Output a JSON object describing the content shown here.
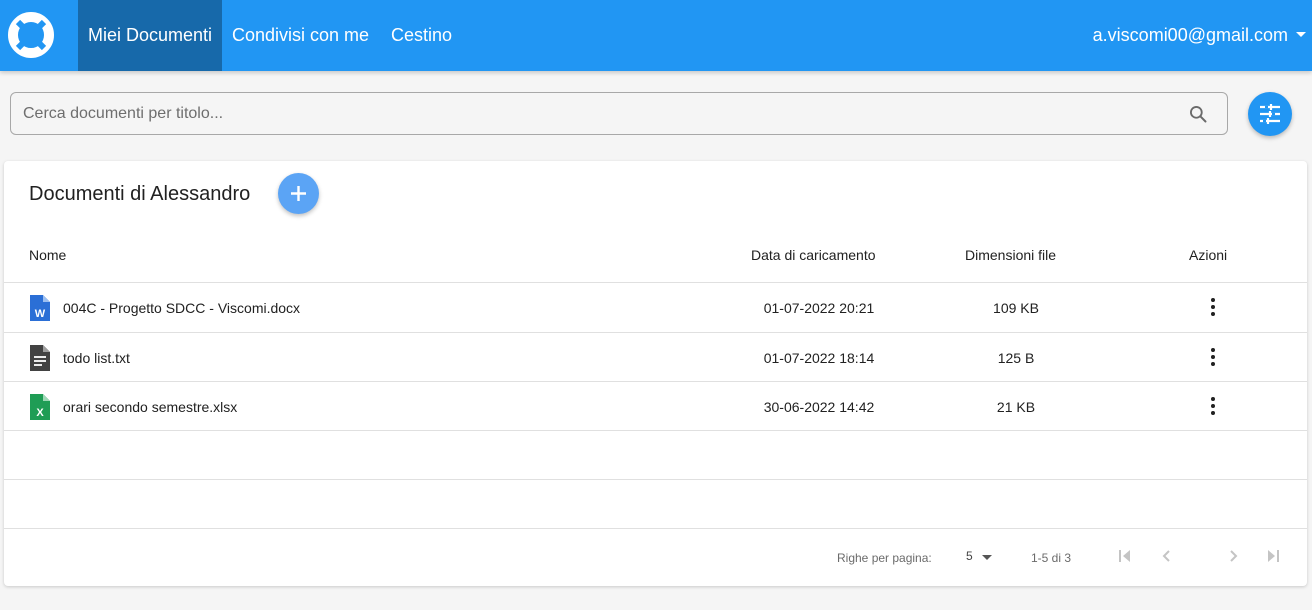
{
  "nav": {
    "tabs": [
      {
        "label": "Miei Documenti",
        "active": true
      },
      {
        "label": "Condivisi con me",
        "active": false
      },
      {
        "label": "Cestino",
        "active": false
      }
    ],
    "user_email": "a.viscomi00@gmail.com"
  },
  "search": {
    "value": "",
    "placeholder": "Cerca documenti per titolo...",
    "icon": "search-icon"
  },
  "filter_button": {
    "icon": "tune-icon"
  },
  "documents": {
    "title": "Documenti di Alessandro",
    "add_icon": "plus-icon",
    "columns": [
      "Nome",
      "Data di caricamento",
      "Dimensioni file",
      "Azioni"
    ],
    "rows": [
      {
        "icon": "word-file-icon",
        "name": "004C - Progetto SDCC - Viscomi.docx",
        "date": "01-07-2022  20:21",
        "size": "109 KB"
      },
      {
        "icon": "text-file-icon",
        "name": "todo list.txt",
        "date": "01-07-2022  18:14",
        "size": "125 B"
      },
      {
        "icon": "excel-file-icon",
        "name": "orari secondo semestre.xlsx",
        "date": "30-06-2022  14:42",
        "size": "21 KB"
      }
    ]
  },
  "pagination": {
    "rows_per_page_label": "Righe per pagina:",
    "rows_per_page": "5",
    "range": "1-5 di 3"
  },
  "colors": {
    "primary": "#2196f3",
    "active_tab": "#1769aa",
    "add_button": "#5ba4f5",
    "word": "#2b6fd6",
    "excel": "#1f9d55",
    "text_file": "#424242"
  }
}
